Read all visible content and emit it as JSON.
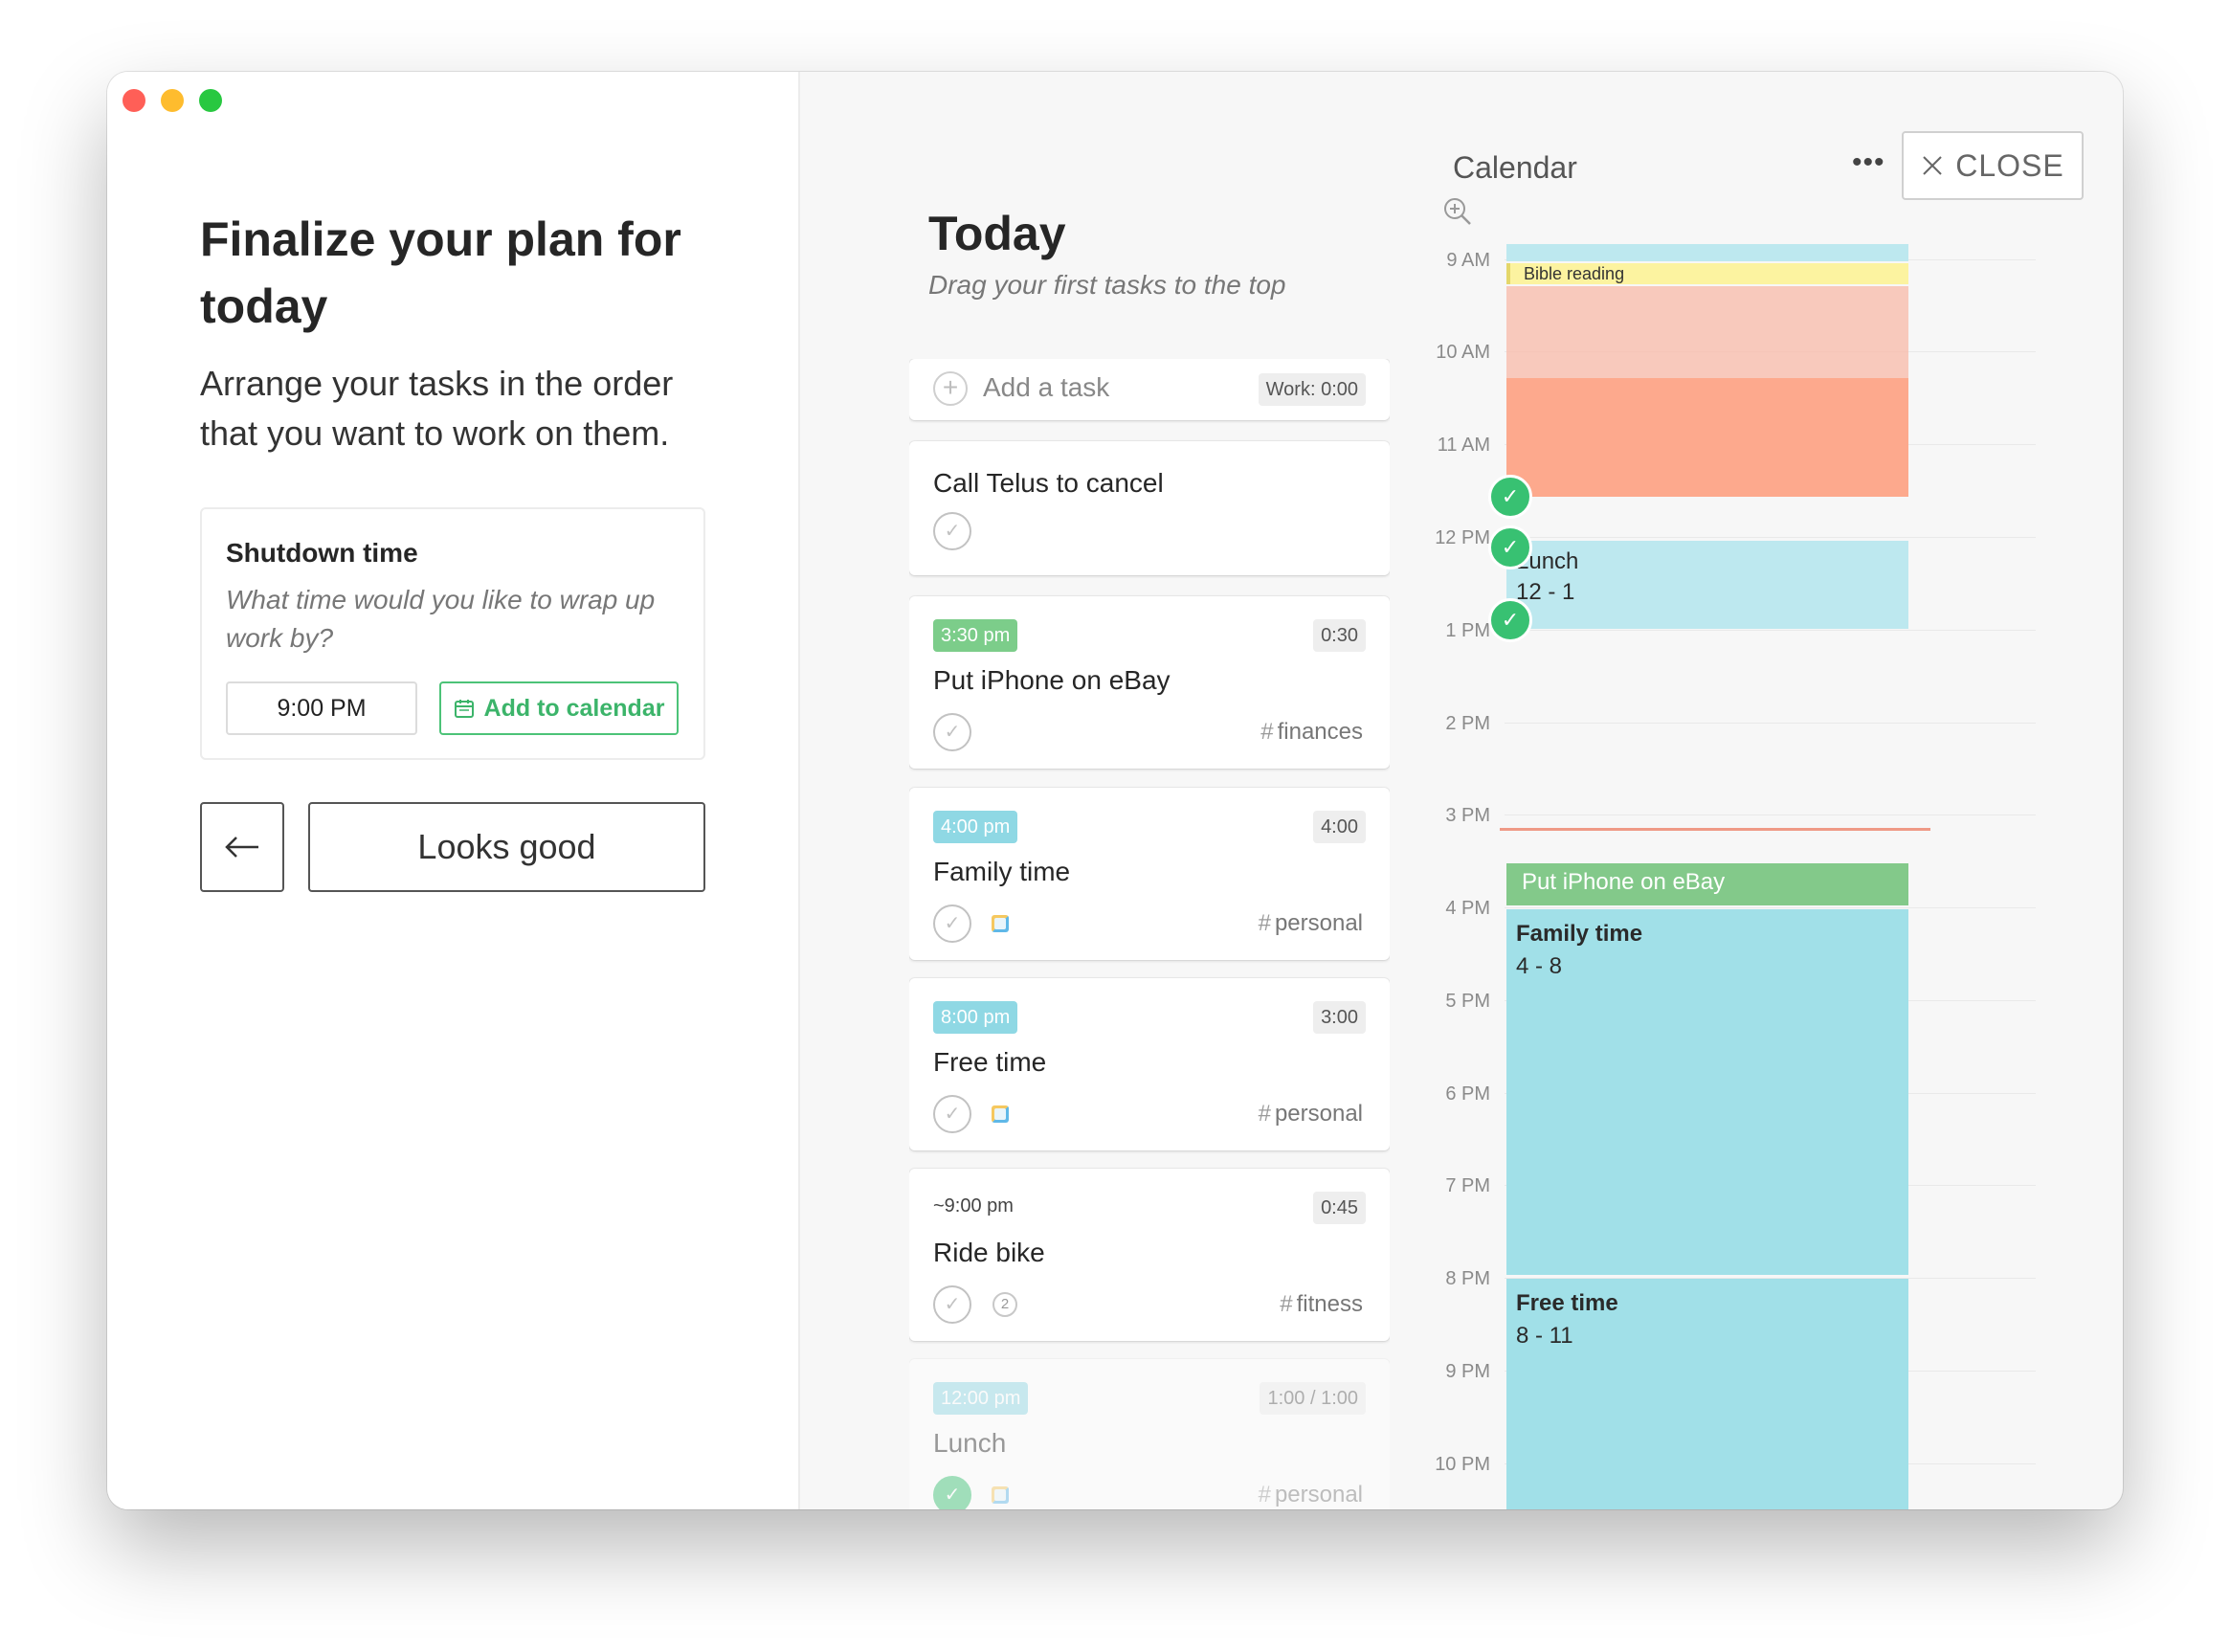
{
  "window": {
    "traffic_lights": [
      "#ff5f57",
      "#febc2e",
      "#28c840"
    ]
  },
  "left": {
    "title": "Finalize your plan for today",
    "description": "Arrange your tasks in the order that you want to work on them.",
    "shutdown": {
      "title": "Shutdown time",
      "question": "What time would you like to wrap up work by?",
      "time_value": "9:00 PM",
      "add_calendar_label": "Add to calendar"
    },
    "back_icon": "arrow-left-icon",
    "looks_good_label": "Looks good"
  },
  "today": {
    "title": "Today",
    "subtitle": "Drag your first tasks to the top",
    "add_task": {
      "label": "Add a task",
      "work_badge": "Work: 0:00"
    },
    "tasks": [
      {
        "name": "Call Telus to cancel"
      },
      {
        "time": "3:30 pm",
        "time_color": "#7ccd8a",
        "duration": "0:30",
        "name": "Put iPhone on eBay",
        "tag": "finances"
      },
      {
        "time": "4:00 pm",
        "time_color": "#8fd8e4",
        "duration": "4:00",
        "name": "Family time",
        "tag": "personal"
      },
      {
        "time": "8:00 pm",
        "time_color": "#8fd8e4",
        "duration": "3:00",
        "name": "Free time",
        "tag": "personal"
      },
      {
        "time": "~9:00 pm",
        "duration": "0:45",
        "name": "Ride bike",
        "tag": "fitness",
        "subtasks": "2"
      },
      {
        "time": "12:00 pm",
        "time_color": "#8fd8e4",
        "duration": "1:00 / 1:00",
        "name": "Lunch",
        "tag": "personal"
      }
    ]
  },
  "calendar": {
    "title": "Calendar",
    "more_icon": "more-horizontal-icon",
    "close_label": "CLOSE",
    "zoom_icon": "zoom-in-icon",
    "hours": [
      "9 AM",
      "10 AM",
      "11 AM",
      "12 PM",
      "1 PM",
      "2 PM",
      "3 PM",
      "4 PM",
      "5 PM",
      "6 PM",
      "7 PM",
      "8 PM",
      "9 PM",
      "10 PM"
    ],
    "events": [
      {
        "title": "Bible reading",
        "color": "#fcf3a0"
      },
      {
        "title": "Lunch",
        "time": "12 - 1",
        "color": "#bde8ef"
      },
      {
        "title": "Put iPhone on eBay",
        "color": "#83c98a"
      },
      {
        "title": "Family time",
        "time": "4 - 8",
        "color": "#a1e0e8"
      },
      {
        "title": "Free time",
        "time": "8 - 11",
        "color": "#a1e0e8"
      }
    ],
    "accent_color": "#38c172",
    "now_line_color": "#ef9a86"
  }
}
